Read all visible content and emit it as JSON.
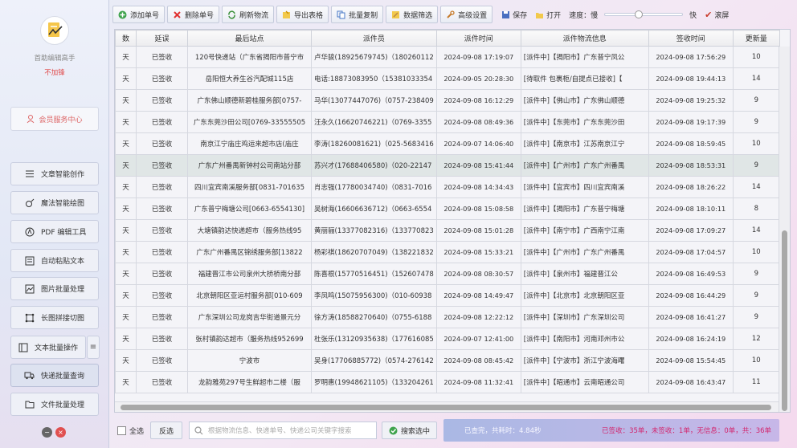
{
  "sidebar": {
    "app_name": "首助编辑高手",
    "vip_status": "不加锋",
    "member_label": "会员服务中心",
    "items": [
      {
        "label": "文章智能创作",
        "icon": "list-icon"
      },
      {
        "label": "魔法智能绘图",
        "icon": "magic-icon"
      },
      {
        "label": "PDF 编辑工具",
        "icon": "pdf-icon"
      },
      {
        "label": "自动粘贴文本",
        "icon": "paste-icon"
      },
      {
        "label": "图片批量处理",
        "icon": "image-icon"
      },
      {
        "label": "长图拼接切图",
        "icon": "crop-icon"
      },
      {
        "label": "文本批量操作",
        "icon": "text-icon"
      },
      {
        "label": "快递批量查询",
        "icon": "truck-icon"
      },
      {
        "label": "文件批量处理",
        "icon": "folder-icon"
      }
    ]
  },
  "toolbar": {
    "add": "添加单号",
    "delete": "删除单号",
    "refresh": "刷新物流",
    "export": "导出表格",
    "copy": "批量复制",
    "filter": "数据筛选",
    "settings": "高级设置",
    "save": "保存",
    "open": "打开",
    "speed_label": "速度：慢",
    "speed_fast": "快",
    "scroll_label": "滚屏",
    "speed_value": 0.42
  },
  "table": {
    "columns": [
      "数",
      "延误",
      "最后站点",
      "派件员",
      "派件时间",
      "派件物流信息",
      "签收时间",
      "更新量"
    ],
    "rows": [
      [
        "天",
        "已签收",
        "120号快递站（广东省揭阳市普宁市",
        "卢华骏(18925679745)（180260112",
        "2024-09-08 17:19:07",
        "[派件中]【揭阳市】广东普宁凤公",
        "2024-09-08 17:56:29",
        "10"
      ],
      [
        "天",
        "已签收",
        "岳阳恒大养生谷汽配城115店",
        "电话:18873083950（15381033354",
        "2024-09-05 20:28:30",
        "[待取件 包裹柜/自提点已接收]【",
        "2024-09-08 19:44:13",
        "14"
      ],
      [
        "天",
        "已签收",
        "广东佛山顺德新碧桂服务部[0757-",
        "马华(13077447076)（0757-238409",
        "2024-09-08 16:12:29",
        "[派件中]【佛山市】广东佛山顺德",
        "2024-09-08 19:25:32",
        "9"
      ],
      [
        "天",
        "已签收",
        "广东东莞沙田公司[0769-33555505",
        "汪永久(16620746221)（0769-3355",
        "2024-09-08 08:49:36",
        "[派件中]【东莞市】广东东莞沙田",
        "2024-09-08 19:17:39",
        "9"
      ],
      [
        "天",
        "已签收",
        "南京江宁庙庄鸡运来超市店(庙庄",
        "李涛(18260081621)（025-5683416",
        "2024-09-07 14:06:40",
        "[派件中]【南京市】江苏南京江宁",
        "2024-09-08 18:59:45",
        "10"
      ],
      [
        "天",
        "已签收",
        "广东广州番禺新钟村公司南站分部",
        "苏兴才(17688406580)（020-22147",
        "2024-09-08 15:41:44",
        "[派件中]【广州市】广东广州番禺",
        "2024-09-08 18:53:31",
        "9"
      ],
      [
        "天",
        "已签收",
        "四川宜宾南溪服务部[0831-701635",
        "肖志强(17780034740)（0831-7016",
        "2024-09-08 14:34:43",
        "[派件中]【宜宾市】四川宜宾南溪",
        "2024-09-08 18:26:22",
        "14"
      ],
      [
        "天",
        "已签收",
        "广东普宁梅塘公司[0663-6554130]",
        "吴树海(16606636712)（0663-6554",
        "2024-09-08 15:08:58",
        "[派件中]【揭阳市】广东普宁梅塘",
        "2024-09-08 18:10:11",
        "8"
      ],
      [
        "天",
        "已签收",
        "大塘镇韵达快递超市（服务热线95",
        "黄丽骊(13377082316)（133770823",
        "2024-09-08 15:01:28",
        "[派件中]【南宁市】广西南宁江南",
        "2024-09-08 17:09:27",
        "14"
      ],
      [
        "天",
        "已签收",
        "广东广州番禺区锦绣服务部[13822",
        "杨彩祺(18620707049)（138221832",
        "2024-09-08 15:33:21",
        "[派件中]【广州市】广东广州番禺",
        "2024-09-08 17:04:57",
        "10"
      ],
      [
        "天",
        "已签收",
        "福建晋江市公司泉州大桥桥南分部",
        "陈喜根(15770516451)（152607478",
        "2024-09-08 08:30:57",
        "[派件中]【泉州市】福建晋江公",
        "2024-09-08 16:49:53",
        "9"
      ],
      [
        "天",
        "已签收",
        "北京朝阳区亚运村服务部[010-609",
        "李凤鸣(15075956300)（010-60938",
        "2024-09-08 14:49:47",
        "[派件中]【北京市】北京朝阳区亚",
        "2024-09-08 16:44:29",
        "9"
      ],
      [
        "天",
        "已签收",
        "广东深圳公司龙岗吉华街道景元分",
        "徐方涛(18588270640)（0755-6188",
        "2024-09-08 12:22:12",
        "[派件中]【深圳市】广东深圳公司",
        "2024-09-08 16:41:27",
        "9"
      ],
      [
        "天",
        "已签收",
        "张村镇韵达超市（服务热线952699",
        "杜张乐(13120935638)（177616085",
        "2024-09-07 12:41:00",
        "[派件中]【南阳市】河南邓州市公",
        "2024-09-08 16:24:19",
        "12"
      ],
      [
        "天",
        "已签收",
        "宁波市",
        "吴身(17706885772)（0574-276142",
        "2024-09-08 08:45:42",
        "[派件中]【宁波市】浙江宁波海曙",
        "2024-09-08 15:54:45",
        "10"
      ],
      [
        "天",
        "已签收",
        "龙韵雅苑297号生鲜超市二楼（服",
        "罗明惠(19948621105)（133204261",
        "2024-09-08 11:32:41",
        "[派件中]【昭通市】云南昭通公司",
        "2024-09-08 16:43:47",
        "11"
      ]
    ],
    "selected_row": 5
  },
  "bottom": {
    "select_all": "全选",
    "invert": "反选",
    "search_placeholder": "根据物流信息、快递单号、快递公司关键字搜索",
    "search_button": "搜索选中",
    "status_done": "已查完，共耗时：4.84秒",
    "status_counts": "已签收：35单，未签收：1单，无信息：0单，共：36单"
  },
  "colors": {
    "accent": "#d2266e",
    "status_bg": "#b3bfe8"
  }
}
